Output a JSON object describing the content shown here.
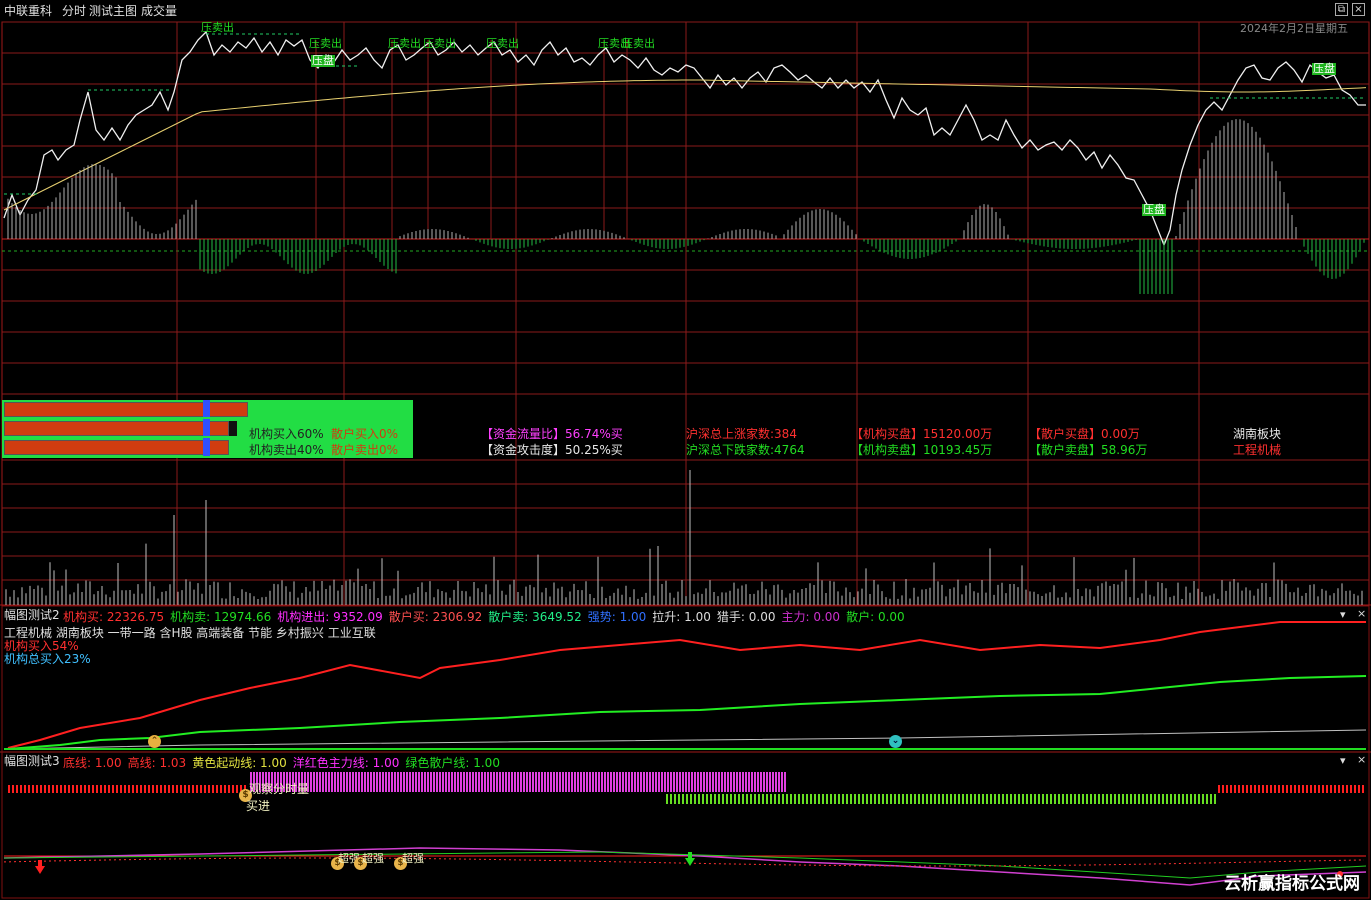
{
  "header": {
    "stock_name": "中联重科",
    "tab_time": "分时",
    "tab_main": "测试主图",
    "tab_volume": "成交量",
    "date": "2024年2月2日星期五"
  },
  "price_panel": {
    "signals": {
      "sell": "压卖出",
      "sell_short": "压卖出",
      "pressure": "压盘"
    }
  },
  "flow_panel": {
    "bars": {
      "buy_inst": "机构买入60%",
      "buy_retail": "散户买入0%",
      "sell_inst": "机构卖出40%",
      "sell_retail": "散户卖出0%"
    },
    "stats": {
      "flow_ratio": "【资金流量比】56.74%买",
      "attack": "【资金攻击度】50.25%买",
      "up_count": "沪深总上涨家数:384",
      "down_count": "沪深总下跌家数:4764",
      "inst_buy": "【机构买盘】15120.00万",
      "inst_sell": "【机构卖盘】10193.45万",
      "retail_buy": "【散户买盘】0.00万",
      "retail_sell": "【散户卖盘】58.96万",
      "sector_label": "湖南板块",
      "sector_value": "工程机械"
    }
  },
  "indicator2": {
    "title": "幅图测试2",
    "items": [
      {
        "label": "机构买:",
        "value": "22326.75",
        "color": "#ff3030"
      },
      {
        "label": "机构卖:",
        "value": "12974.66",
        "color": "#22dd22"
      },
      {
        "label": "机构进出:",
        "value": "9352.09",
        "color": "#ff30ff"
      },
      {
        "label": "散户买:",
        "value": "2306.92",
        "color": "#ff5050"
      },
      {
        "label": "散户卖:",
        "value": "3649.52",
        "color": "#22ee88"
      },
      {
        "label": "强势:",
        "value": "1.00",
        "color": "#3070ff"
      },
      {
        "label": "拉升:",
        "value": "1.00",
        "color": "#dddddd"
      },
      {
        "label": "猎手:",
        "value": "0.00",
        "color": "#dddddd"
      },
      {
        "label": "主力:",
        "value": "0.00",
        "color": "#cc30cc"
      },
      {
        "label": "散户:",
        "value": "0.00",
        "color": "#22dd22"
      }
    ],
    "concepts": "工程机械 湖南板块 一带一路 含H股 高端装备 节能 乡村振兴 工业互联",
    "inst_buy_pct": "机构买入54%",
    "inst_total_pct": "机构总买入23%"
  },
  "indicator3": {
    "title": "幅图测试3",
    "items": [
      {
        "label": "底线:",
        "value": "1.00",
        "color": "#ff3030"
      },
      {
        "label": "高线:",
        "value": "1.03",
        "color": "#ff3030"
      },
      {
        "label": "黄色起动线:",
        "value": "1.00",
        "color": "#e0e040"
      },
      {
        "label": "洋红色主力线:",
        "value": "1.00",
        "color": "#ff30ff"
      },
      {
        "label": "绿色散户线:",
        "value": "1.00",
        "color": "#22dd22"
      }
    ],
    "note1": "观察分时量",
    "note2": "买进",
    "strong": "超强",
    "strong2": "超强",
    "strong3": "超强"
  },
  "watermark": "云析赢指标公式网",
  "controls": {
    "dropdown": "▾",
    "close": "×",
    "plus": "+",
    "restore": "⧉"
  }
}
